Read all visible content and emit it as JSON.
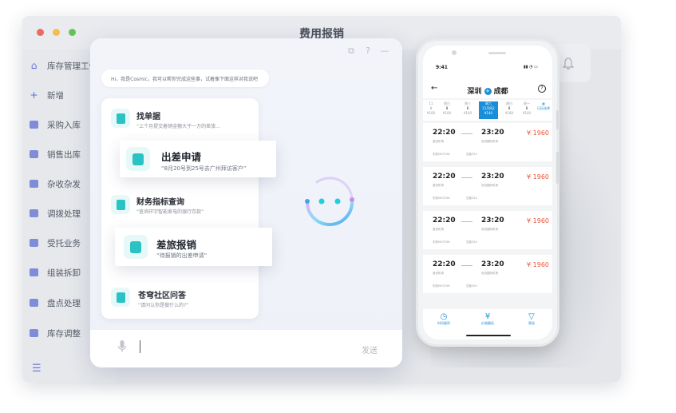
{
  "window": {
    "title": "费用报销",
    "traffic_colors": [
      "#ee6a5f",
      "#f5bd4f",
      "#61c454"
    ]
  },
  "sidebar": {
    "items": [
      {
        "label": "库存管理工作",
        "icon": "home-icon"
      },
      {
        "label": "新增",
        "icon": "plus-icon"
      },
      {
        "label": "采购入库",
        "icon": "inbound-icon"
      },
      {
        "label": "销售出库",
        "icon": "outbound-icon"
      },
      {
        "label": "杂收杂发",
        "icon": "misc-icon"
      },
      {
        "label": "调拨处理",
        "icon": "transfer-icon"
      },
      {
        "label": "受托业务",
        "icon": "entrusted-icon"
      },
      {
        "label": "组装拆卸",
        "icon": "assembly-icon"
      },
      {
        "label": "盘点处理",
        "icon": "inventory-icon"
      },
      {
        "label": "库存调整",
        "icon": "adjust-icon"
      }
    ]
  },
  "chat": {
    "greeting": "Hi，我是Cosmic，我可以帮你完成这些事，试着像下面这样对我说吧",
    "features": [
      {
        "title": "找单据",
        "subtitle": "“上个月提交着销金额大于一万的差旅...",
        "icon": "document-icon"
      },
      {
        "title": "出差申请",
        "subtitle": "“8月20号到25号去广州拜访客户”",
        "icon": "briefcase-icon"
      },
      {
        "title": "财务指标查询",
        "subtitle": "“查询环宇智能家电的银行存款”",
        "icon": "chart-icon"
      },
      {
        "title": "差旅报销",
        "subtitle": "“待报销的出差申请”",
        "icon": "receipt-icon"
      },
      {
        "title": "苍穹社区问答",
        "subtitle": "“请问认你是做什么的?”",
        "icon": "chat-bubble-icon"
      }
    ],
    "send_label": "发送"
  },
  "phone": {
    "status_time": "9:41",
    "route_from": "深圳",
    "route_to": "成都",
    "dates": [
      {
        "top": "11",
        "mid": "8",
        "bot": "¥100"
      },
      {
        "top": "周日",
        "mid": "8",
        "bot": "¥100"
      },
      {
        "top": "周三",
        "mid": "8",
        "bot": "¥140"
      },
      {
        "top": "周六",
        "mid": "11月8日",
        "bot": "¥140"
      },
      {
        "top": "周日",
        "mid": "8",
        "bot": "¥180"
      },
      {
        "top": "周一",
        "mid": "8",
        "bot": "¥100"
      },
      {
        "top": "",
        "mid": "日历选择",
        "bot": ""
      }
    ],
    "flights": [
      {
        "dep": "22:20",
        "arr": "23:20",
        "price": "¥ 1960",
        "dep_airport": "宝安机场",
        "arr_airport": "双流国际机场",
        "airline": "东航MU3708",
        "note": "空客320"
      },
      {
        "dep": "22:20",
        "arr": "23:20",
        "price": "¥ 1960",
        "dep_airport": "宝安机场",
        "arr_airport": "双流国际机场",
        "airline": "东航MU3708",
        "note": "空客320"
      },
      {
        "dep": "22:20",
        "arr": "23:20",
        "price": "¥ 1960",
        "dep_airport": "宝安机场",
        "arr_airport": "双流国际机场",
        "airline": "东航MU3708",
        "note": "空客320"
      },
      {
        "dep": "22:20",
        "arr": "23:20",
        "price": "¥ 1960",
        "dep_airport": "宝安机场",
        "arr_airport": "双流国际机场",
        "airline": "东航MU3708",
        "note": "空客320"
      }
    ],
    "tabs": [
      {
        "label": "时间顺序",
        "glyph": "◷"
      },
      {
        "label": "价格最低",
        "glyph": "¥"
      },
      {
        "label": "筛选",
        "glyph": "▽"
      }
    ],
    "accent": "#1a8ed8",
    "price_color": "#e8553d"
  }
}
